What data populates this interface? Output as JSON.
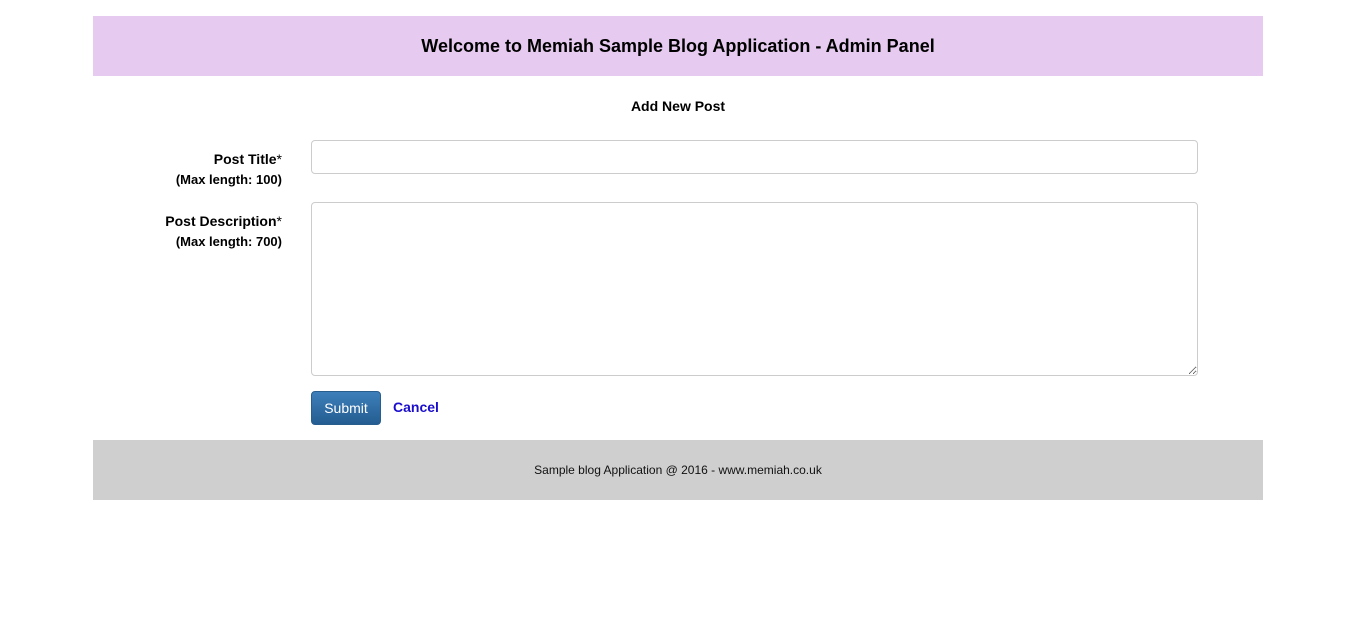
{
  "header": {
    "title": "Welcome to Memiah Sample Blog Application - Admin Panel"
  },
  "page": {
    "heading": "Add New Post"
  },
  "form": {
    "title_label": "Post Title",
    "title_required": "*",
    "title_hint": "(Max length: 100)",
    "title_value": "",
    "description_label": "Post Description",
    "description_required": "*",
    "description_hint": "(Max length: 700)",
    "description_value": "",
    "submit_label": "Submit",
    "cancel_label": "Cancel"
  },
  "footer": {
    "text": "Sample blog Application @ 2016 - www.memiah.co.uk"
  },
  "colors": {
    "header_bg": "#e6caf0",
    "footer_bg": "#cfcfcf",
    "submit_bg": "#2f6ea5",
    "link": "#1a0dcc"
  }
}
